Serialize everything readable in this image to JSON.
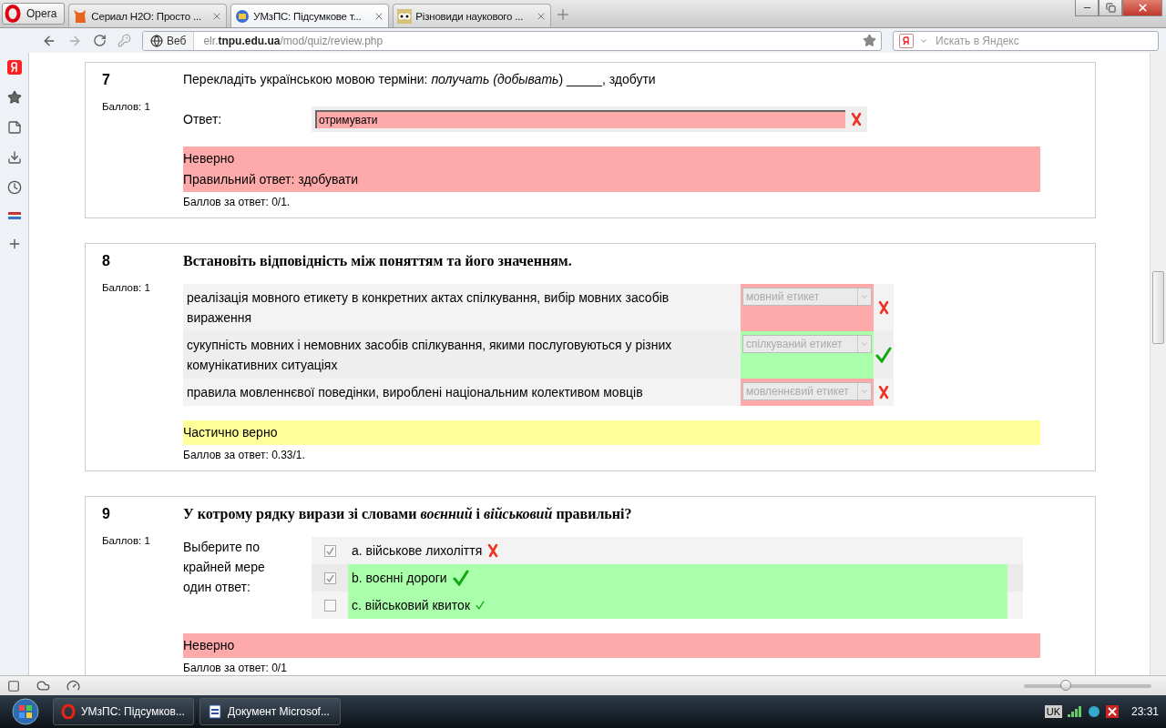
{
  "browser": {
    "menu_button": "Opera",
    "tabs": [
      {
        "label": "Сериал H2O: Просто ...",
        "selected": false
      },
      {
        "label": "УМзПС: Підсумкове т...",
        "selected": true
      },
      {
        "label": "Різновиди наукового ...",
        "selected": false
      }
    ],
    "web_badge": "Веб",
    "address": {
      "host_pre": "elr.",
      "host": "tnpu.edu.ua",
      "path": "/mod/quiz/review.php"
    },
    "search": {
      "placeholder": "Искать в Яндекс"
    }
  },
  "questions": [
    {
      "number": "7",
      "points": "Баллов: 1",
      "kind": "short",
      "text": "Перекладіть українською мовою терміни: *получать (добывать*) _____, здобути",
      "answer_label": "Ответ:",
      "answer": "отримувати",
      "correct": false,
      "feedback": [
        {
          "kind": "incorrect",
          "lines": [
            "Неверно",
            "Правильний ответ: здобувати"
          ]
        }
      ],
      "score": "Баллов за ответ: 0/1."
    },
    {
      "number": "8",
      "points": "Баллов: 1",
      "kind": "match",
      "text": "Встановіть відповідність між поняттям та його значенням.",
      "rows": [
        {
          "text": "реалізація мовного етикету в конкретних актах спілкування, вибір мовних засобів вираження",
          "choice": "мовний етикет",
          "correct": false
        },
        {
          "text": "сукупність мовних і немовних засобів спілкування, якими послуговуються у різних комунікативних ситуаціях",
          "choice": "спілкуваний етикет",
          "correct": true
        },
        {
          "text": "правила мовленнєвої поведінки, вироблені національним колективом мовців",
          "choice": "мовленнєвий етикет",
          "correct": false
        }
      ],
      "feedback": [
        {
          "kind": "partial",
          "lines": [
            "Частично верно"
          ]
        }
      ],
      "score": "Баллов за ответ: 0.33/1."
    },
    {
      "number": "9",
      "points": "Баллов: 1",
      "kind": "multi",
      "text": "У котрому рядку вирази зі словами *воєнний* і *військовий* правильні?",
      "prompt": "Выберите по крайней мере один ответ:",
      "options": [
        {
          "label": "a. військове лихоліття",
          "checked": true,
          "correct": false,
          "kind": "cross"
        },
        {
          "label": "b. воєнні дороги",
          "checked": true,
          "correct": true,
          "kind": "tick"
        },
        {
          "label": "c. військовий квиток",
          "checked": false,
          "correct": true,
          "kind": "small"
        }
      ],
      "feedback": [
        {
          "kind": "incorrect",
          "lines": [
            "Неверно"
          ]
        }
      ],
      "score": "Баллов за ответ: 0/1"
    }
  ],
  "status_bar": {
    "zoom": {
      "level": 0.33
    }
  },
  "taskbar": {
    "items": [
      {
        "label": "УМзПС: Підсумков..."
      },
      {
        "label": "Документ Microsof..."
      }
    ],
    "language": "UK",
    "time": "23:31"
  }
}
